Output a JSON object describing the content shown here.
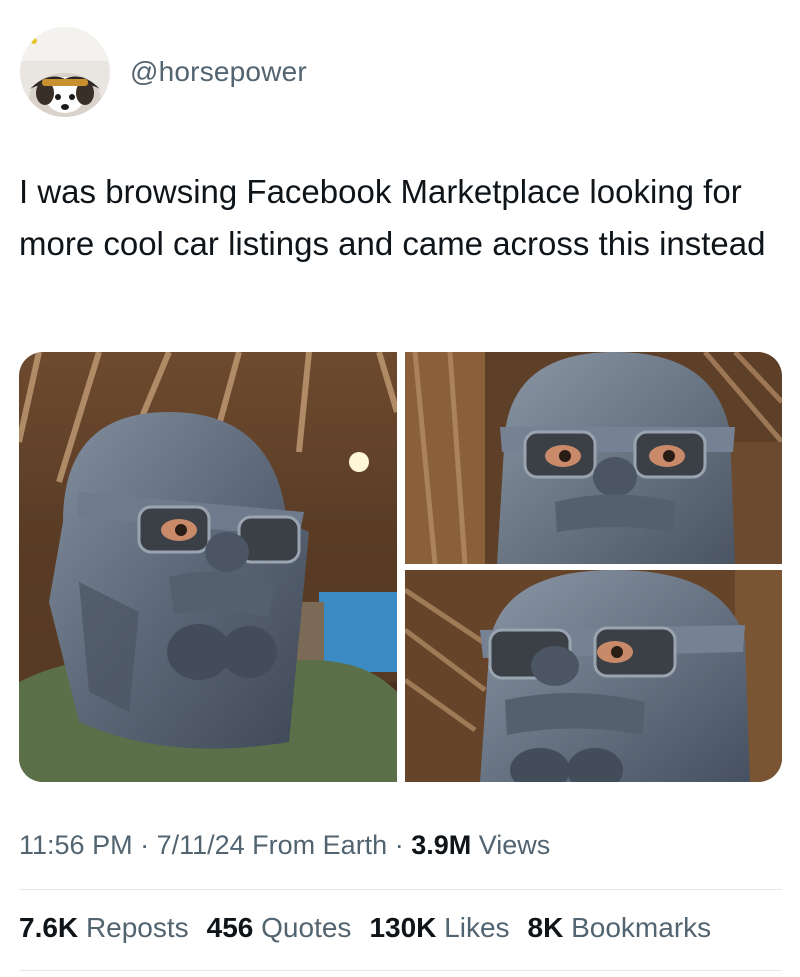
{
  "tweet": {
    "handle": "@horsepower",
    "text": "I was browsing Facebook Marketplace looking for more cool car listings and came across this instead",
    "meta": {
      "time": "11:56 PM",
      "sep1": " · ",
      "date": "7/11/24",
      "source": " From Earth",
      "sep2": " · ",
      "views_count": "3.9M",
      "views_label": " Views"
    },
    "stats": [
      {
        "count": "7.6K",
        "label": "Reposts"
      },
      {
        "count": "456",
        "label": "Quotes"
      },
      {
        "count": "130K",
        "label": "Likes"
      },
      {
        "count": "8K",
        "label": "Bookmarks"
      }
    ]
  },
  "colors": {
    "text_primary": "#0f1419",
    "text_secondary": "#536471",
    "divider": "#e6e9ec",
    "helmet": "#5f6b7c"
  }
}
